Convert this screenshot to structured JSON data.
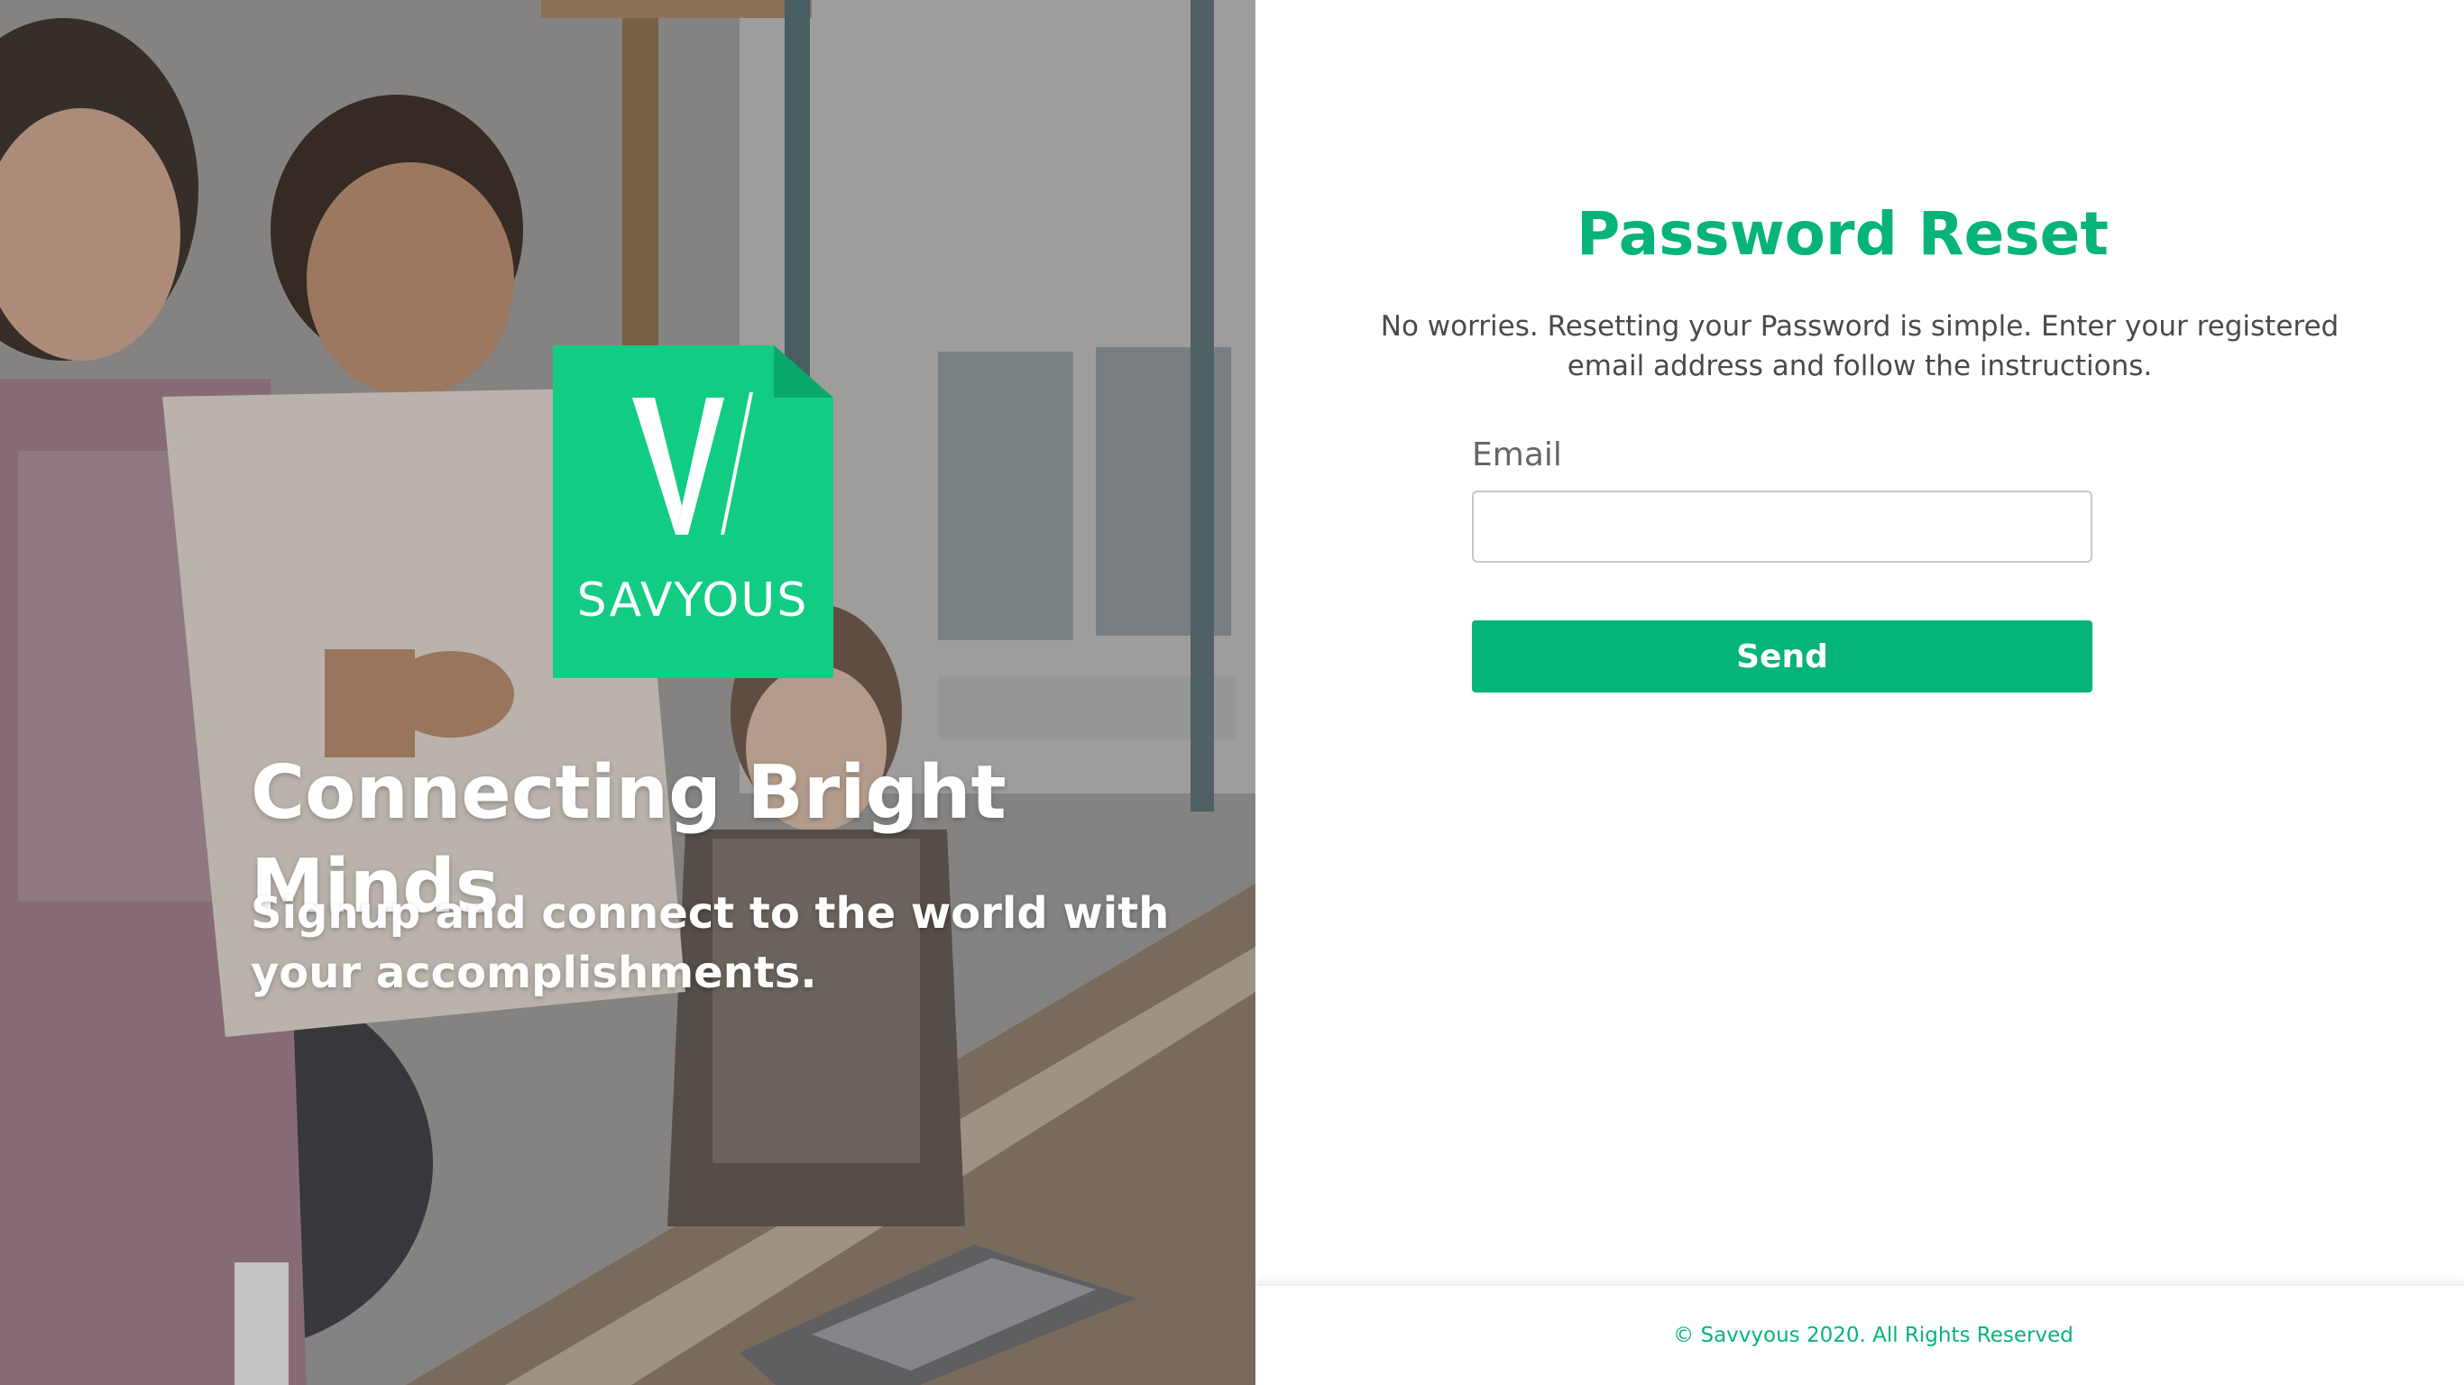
{
  "hero": {
    "brand_name": "SAVYOUS",
    "tagline": "Connecting Bright Minds",
    "subtagline": "Signup and connect to the world with your accomplishments."
  },
  "form": {
    "title": "Password Reset",
    "intro": "No worries. Resetting your Password is simple. Enter your registered email address and follow the instructions.",
    "email_label": "Email",
    "email_value": "",
    "email_placeholder": "",
    "send_label": "Send"
  },
  "footer": {
    "copyright": "© Savvyous 2020. All Rights Reserved"
  },
  "colors": {
    "brand_green": "#06b477",
    "logo_tile_green": "#12cc84"
  }
}
